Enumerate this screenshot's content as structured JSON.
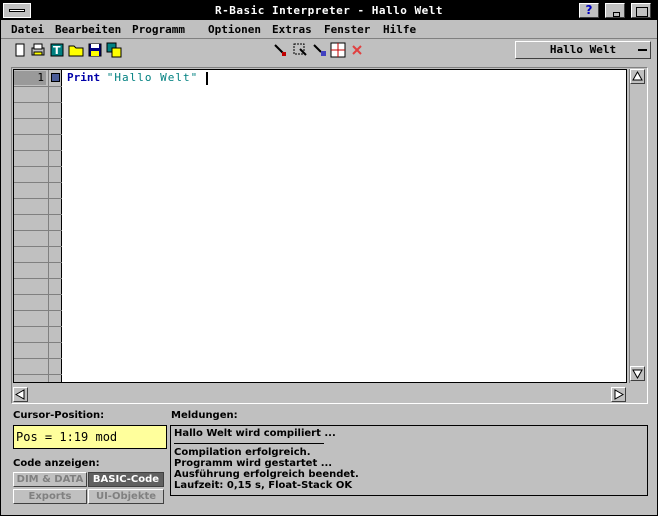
{
  "window": {
    "title": "R-Basic Interpreter - Hallo Welt",
    "help_label": "?"
  },
  "menu": [
    {
      "label": "Datei"
    },
    {
      "label": "Bearbeiten"
    },
    {
      "label": "Programm"
    },
    {
      "label": "Optionen"
    },
    {
      "label": "Extras"
    },
    {
      "label": "Fenster"
    },
    {
      "label": "Hilfe"
    }
  ],
  "toolbar": {
    "icons": [
      "new-file-icon",
      "print-icon",
      "text-icon",
      "open-folder-icon",
      "save-icon",
      "save-as-icon",
      "compile-icon",
      "select-icon",
      "run-icon",
      "grid-icon",
      "delete-icon"
    ],
    "document_selector": "Hallo Welt"
  },
  "editor": {
    "lines": [
      {
        "number": "1",
        "keyword": "Print",
        "string": "\"Hallo Welt\""
      }
    ]
  },
  "status": {
    "cursor_label": "Cursor-Position:",
    "cursor_value": "Pos = 1:19  mod",
    "code_label": "Code anzeigen:",
    "code_buttons": {
      "dim_data": "DIM & DATA",
      "basic_code": "BASIC-Code",
      "exports": "Exports",
      "ui_objects": "UI-Objekte"
    },
    "messages_label": "Meldungen:",
    "messages": [
      "Hallo Welt wird compiliert ...",
      "Compilation erfolgreich.",
      "Programm wird gestartet ...",
      "Ausführung erfolgreich beendet.",
      "Laufzeit: 0,15 s, Float-Stack OK"
    ]
  },
  "colors": {
    "background": "#c0c0c0",
    "keyword": "#0000a8",
    "string": "#008080",
    "cursor_box": "#ffff9c"
  }
}
